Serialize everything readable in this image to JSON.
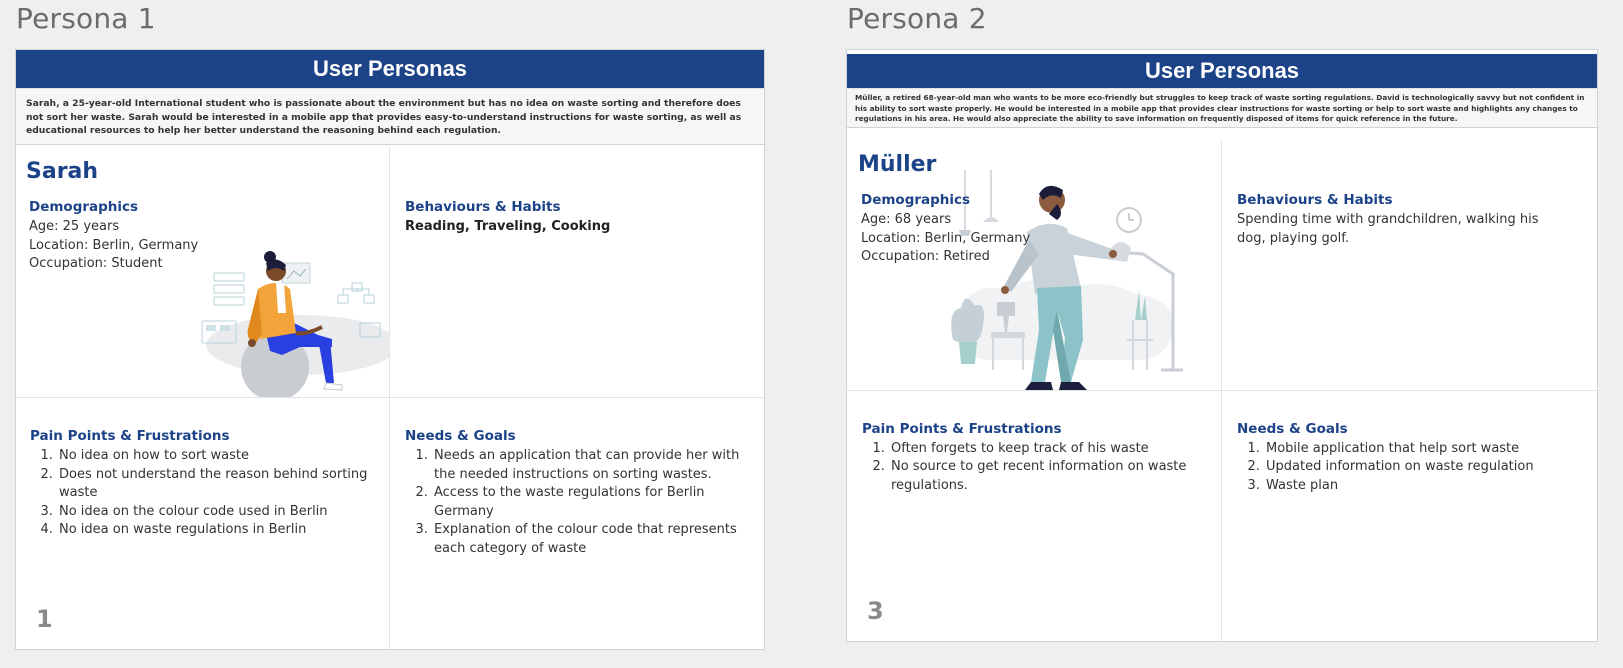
{
  "frames": {
    "left_title": "Persona 1",
    "right_title": "Persona 2"
  },
  "persona1": {
    "banner": "User Personas",
    "summary": "Sarah, a 25-year-old International student who is passionate about the environment but has no idea on waste sorting and therefore does not sort her waste. Sarah would be interested in a mobile app that provides easy-to-understand instructions for waste sorting, as well as educational resources to help her better understand the reasoning behind each regulation.",
    "name": "Sarah",
    "demographics_title": "Demographics",
    "demographics": [
      "Age: 25 years",
      "Location: Berlin, Germany",
      "Occupation: Student"
    ],
    "behaviours_title": "Behaviours & Habits",
    "behaviours": "Reading, Traveling, Cooking",
    "pain_title": "Pain Points & Frustrations",
    "pain_points": [
      "No idea on how to sort waste",
      "Does not understand the reason behind sorting waste",
      "No idea on the colour code used in Berlin",
      "No idea on waste regulations in Berlin"
    ],
    "needs_title": "Needs & Goals",
    "needs": [
      "Needs an application that can provide her with the needed instructions on sorting wastes.",
      "Access to the waste regulations for Berlin Germany",
      "Explanation of the colour code that represents each category of waste"
    ],
    "page_number": "1"
  },
  "persona2": {
    "banner": "User Personas",
    "summary": "Müller, a retired 68-year-old man who wants to be more eco-friendly but struggles to keep track of waste sorting regulations. David is technologically savvy but not confident in his ability to sort waste properly. He would be interested in a mobile app that provides clear instructions for waste sorting or help to sort waste and highlights any changes to regulations in his area. He would also appreciate the ability to save information on frequently disposed of items for quick reference in the future.",
    "name": "Müller",
    "demographics_title": "Demographics",
    "demographics": [
      "Age: 68 years",
      "Location: Berlin, Germany",
      "Occupation: Retired"
    ],
    "behaviours_title": "Behaviours & Habits",
    "behaviours": "Spending time with grandchildren, walking his dog, playing golf.",
    "pain_title": "Pain Points & Frustrations",
    "pain_points": [
      "Often forgets to keep track of his waste",
      "No source to get recent information on waste regulations."
    ],
    "needs_title": "Needs & Goals",
    "needs": [
      "Mobile application that help sort waste",
      "Updated information on waste regulation",
      "Waste plan"
    ],
    "page_number": "3"
  },
  "colors": {
    "banner": "#1c4288",
    "accent": "#1c4288",
    "background": "#efefef"
  }
}
